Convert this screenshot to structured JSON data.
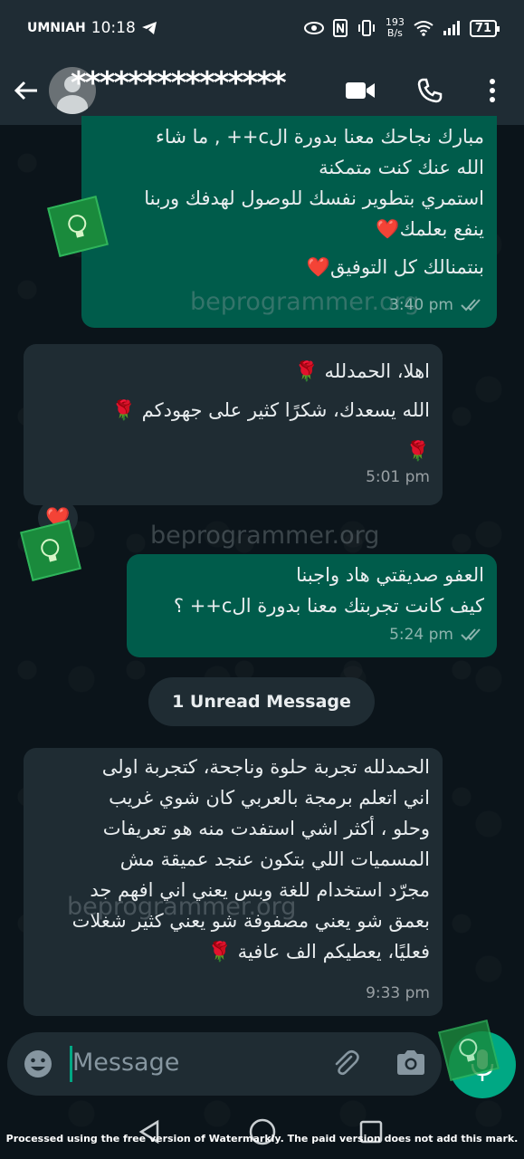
{
  "status_bar": {
    "carrier": "UMNIAH",
    "time": "10:18",
    "net_speed_value": "193",
    "net_speed_unit": "B/s",
    "battery": "71"
  },
  "header": {
    "contact_name": "***************",
    "icons": [
      "back-arrow-icon",
      "avatar",
      "video-call-icon",
      "phone-icon",
      "more-vertical-icon"
    ]
  },
  "watermark_text": "beprogrammer.org",
  "messages": [
    {
      "direction": "out",
      "lines": [
        "مبارك نجاحك معنا بدورة الc++ , ما شاء",
        "الله عنك كنت متمكنة",
        "استمري بتطوير نفسك للوصول لهدفك وربنا",
        "ينفع بعلمك❤️",
        "بنتمنالك كل التوفيق❤️"
      ],
      "time": "3:40 pm"
    },
    {
      "direction": "in",
      "lines": [
        "اهلا، الحمدلله 🌹",
        "الله يسعدك، شكرًا كثير على جهودكم 🌹",
        "🌹"
      ],
      "time": "5:01 pm",
      "reaction": "❤️"
    },
    {
      "direction": "out",
      "lines": [
        "العفو صديقتي هاد واجبنا",
        "كيف كانت تجربتك معنا بدورة الc++ ؟"
      ],
      "time": "5:24 pm"
    },
    {
      "direction": "in",
      "lines": [
        "الحمدلله تجربة حلوة وناجحة، كتجربة اولى",
        "اني اتعلم برمجة بالعربي كان شوي غريب",
        "وحلو ، أكثر اشي استفدت منه هو تعريفات",
        "المسميات اللي بتكون عنجد عميقة مش",
        "مجرّد استخدام للغة وبس يعني اني افهم جد",
        "بعمق شو يعني مصفوفة شو يعني كثير شغلات",
        "فعليًا، يعطيكم الف عافية 🌹"
      ],
      "time": "9:33 pm"
    }
  ],
  "unread_divider": "1 Unread Message",
  "composer": {
    "placeholder": "Message",
    "icons": [
      "emoji-icon",
      "attach-icon",
      "camera-icon",
      "mic-icon"
    ]
  },
  "footer_note": "Processed using the free version of Watermarkly. The paid version does not add this mark.",
  "colors": {
    "outgoing_bubble": "#005c4b",
    "incoming_bubble": "#1f2c33",
    "header": "#1f2c34",
    "background": "#0b141a",
    "accent": "#00a884"
  }
}
